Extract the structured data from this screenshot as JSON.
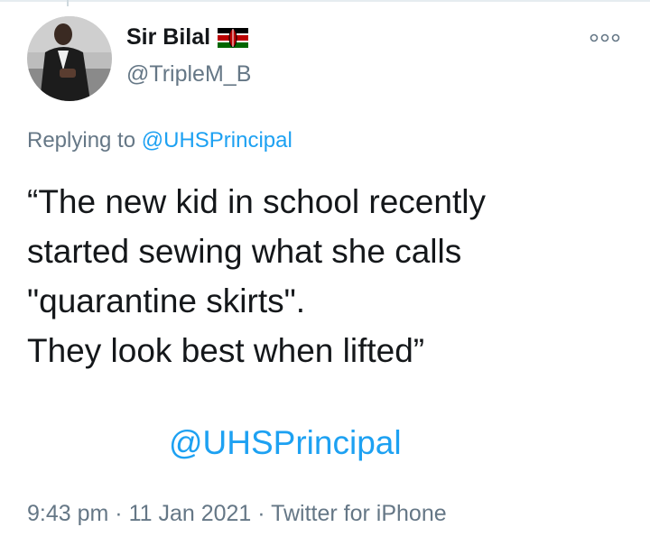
{
  "user": {
    "display_name": "Sir Bilal",
    "username": "@TripleM_B",
    "flag_icon": "kenya-flag-icon"
  },
  "more_icon": "more-options-icon",
  "reply": {
    "prefix": "Replying to ",
    "handle": "@UHSPrincipal"
  },
  "tweet": {
    "text": "“The new kid in school recently\nstarted sewing what she calls\n\"quarantine skirts\".\nThey look best when lifted”",
    "mention": "@UHSPrincipal"
  },
  "meta": {
    "time": "9:43 pm",
    "date": "11 Jan 2021",
    "source": "Twitter for iPhone",
    "separator": " · "
  },
  "colors": {
    "link": "#1da1f2",
    "secondary": "#657786",
    "text": "#14171a"
  }
}
